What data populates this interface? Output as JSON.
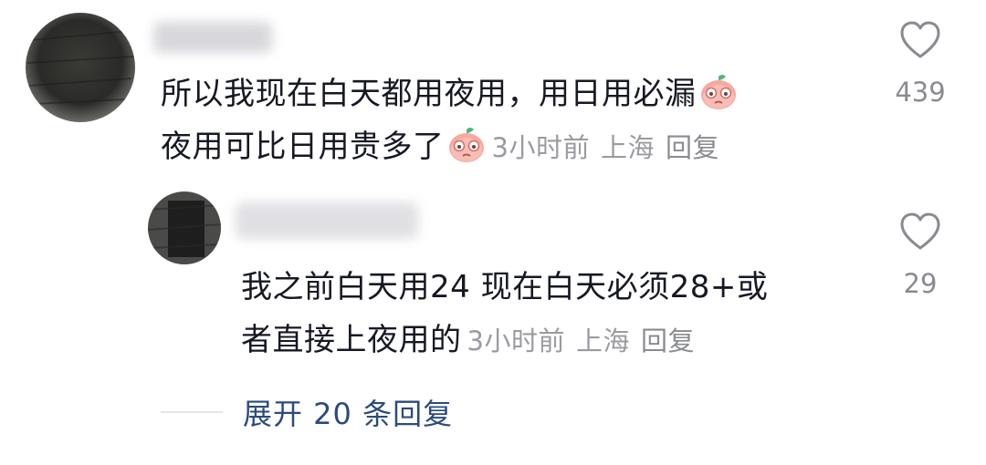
{
  "comments": [
    {
      "text": "所以我现在白天都用夜用，用日用必漏",
      "text_line2": "夜用可比日用贵多了",
      "emoji_1": "nervous-peach-emoji",
      "emoji_2": "nervous-peach-emoji",
      "time": "3小时前",
      "location": "上海",
      "reply_label": "回复",
      "likes": "439"
    }
  ],
  "replies": [
    {
      "text": "我之前白天用24 现在白天必须28+或",
      "text_line2": "者直接上夜用的",
      "time": "3小时前",
      "location": "上海",
      "reply_label": "回复",
      "likes": "29"
    }
  ],
  "expand": {
    "label": "展开 20 条回复"
  },
  "colors": {
    "text": "#161823",
    "meta": "#9a9ba0",
    "link": "#2b4a7f",
    "icon": "#8a8b90"
  },
  "icons": {
    "like": "heart-outline-icon"
  }
}
